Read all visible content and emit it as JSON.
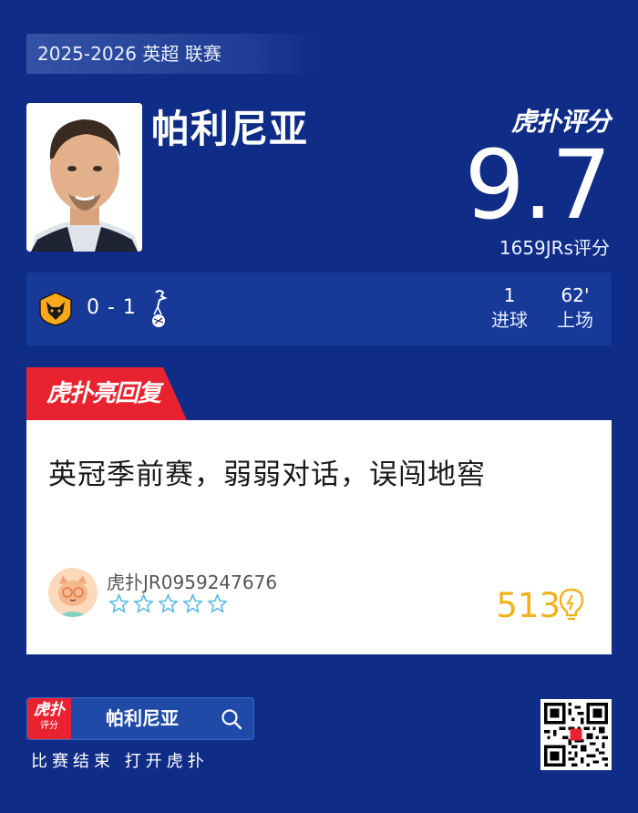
{
  "league": "2025-2026 英超 联赛",
  "player": {
    "name": "帕利尼亚"
  },
  "brand": {
    "logo_text": "虎扑评分"
  },
  "rating": {
    "score": "9.7",
    "count_text": "1659JRs评分"
  },
  "match": {
    "home_team_icon": "wolves-badge-icon",
    "away_team_icon": "tottenham-badge-icon",
    "score": "0 - 1",
    "stats": [
      {
        "value": "1",
        "label": "进球"
      },
      {
        "value": "62'",
        "label": "上场"
      }
    ]
  },
  "reply": {
    "tab_label": "虎扑亮回复",
    "text": "英冠季前赛，弱弱对话，误闯地窖",
    "username": "虎扑JR0959247676",
    "stars_filled": 0,
    "stars_total": 5,
    "likes": "513",
    "like_icon": "lightbulb-icon"
  },
  "footer": {
    "app_logo": "虎扑",
    "app_logo_sub": "评分",
    "search_text": "帕利尼亚",
    "caption": "比赛结束 打开虎扑"
  },
  "colors": {
    "background": "#0f2d87",
    "accent_red": "#e8232f",
    "like_gold": "#f2b21c"
  }
}
